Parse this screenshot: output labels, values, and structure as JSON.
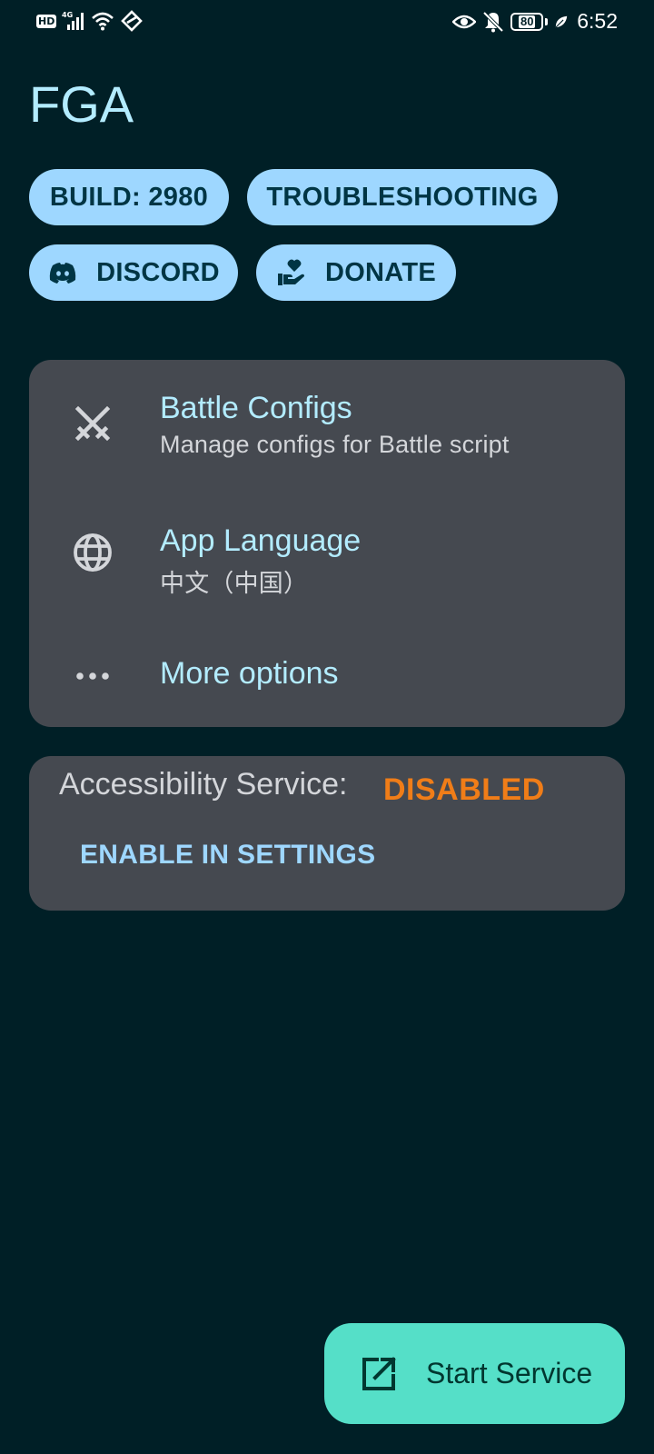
{
  "status_bar": {
    "hd_badge": "HD",
    "network": "4G",
    "battery_level": "80",
    "time": "6:52",
    "icons": [
      "hd-icon",
      "signal-icon",
      "wifi-icon",
      "data-saver-icon",
      "eye-icon",
      "bell-off-icon",
      "battery-icon",
      "leaf-icon"
    ]
  },
  "header": {
    "title": "FGA"
  },
  "chips": {
    "build": "BUILD: 2980",
    "troubleshooting": "TROUBLESHOOTING",
    "discord": "DISCORD",
    "donate": "DONATE"
  },
  "menu": {
    "items": [
      {
        "label": "Battle Configs",
        "subtitle": "Manage configs for Battle script",
        "icon": "crossed-swords-icon"
      },
      {
        "label": "App Language",
        "subtitle": "中文（中国）",
        "icon": "globe-icon"
      },
      {
        "label": "More options",
        "icon": "more-horiz-icon"
      }
    ]
  },
  "accessibility": {
    "label": "Accessibility Service:",
    "status": "DISABLED",
    "status_color": "#f07d18",
    "action": "ENABLE IN SETTINGS"
  },
  "fab": {
    "label": "Start Service",
    "icon": "open-external-icon"
  },
  "colors": {
    "background": "#001f26",
    "title": "#b3ecff",
    "chip_bg": "#9ed7ff",
    "card_bg": "#454950",
    "fab_bg": "#55dfc8"
  }
}
